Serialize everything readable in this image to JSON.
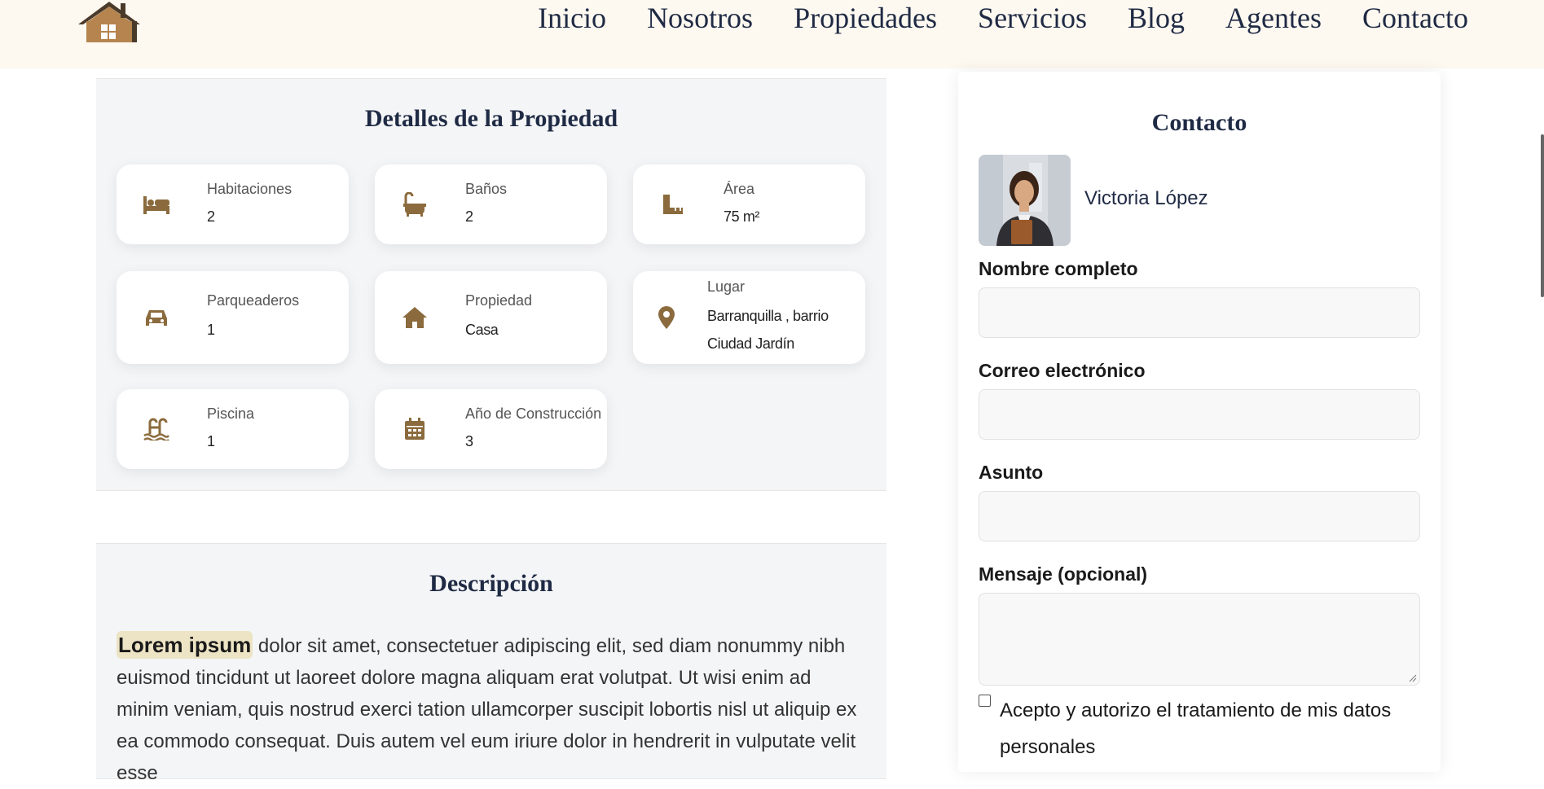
{
  "nav": {
    "items": [
      "Inicio",
      "Nosotros",
      "Propiedades",
      "Servicios",
      "Blog",
      "Agentes",
      "Contacto"
    ]
  },
  "details": {
    "title": "Detalles de la Propiedad",
    "cards": [
      {
        "label": "Habitaciones",
        "value": "2",
        "icon": "bed-icon"
      },
      {
        "label": "Baños",
        "value": "2",
        "icon": "bathtub-icon"
      },
      {
        "label": "Área",
        "value": "75 m²",
        "icon": "ruler-icon"
      },
      {
        "label": "Parqueaderos",
        "value": "1",
        "icon": "car-icon"
      },
      {
        "label": "Propiedad",
        "value": "Casa",
        "icon": "house-icon"
      },
      {
        "label": "Lugar",
        "value": "Barranquilla , barrio Ciudad Jardín",
        "icon": "location-pin-icon"
      },
      {
        "label": "Piscina",
        "value": "1",
        "icon": "swimming-pool-icon"
      },
      {
        "label": "Año de Construcción",
        "value": "3",
        "icon": "calendar-icon"
      }
    ]
  },
  "description": {
    "title": "Descripción",
    "highlight": "Lorem ipsum",
    "text": " dolor sit amet, consectetuer adipiscing elit, sed diam nonummy nibh euismod tincidunt ut laoreet dolore magna aliquam erat volutpat. Ut wisi enim ad minim veniam, quis nostrud exerci tation ullamcorper suscipit lobortis nisl ut aliquip ex ea commodo consequat. Duis autem vel eum iriure dolor in hendrerit in vulputate velit esse"
  },
  "contact": {
    "title": "Contacto",
    "agent_name": "Victoria López",
    "fields": [
      {
        "label": "Nombre completo",
        "value": ""
      },
      {
        "label": "Correo electrónico",
        "value": ""
      },
      {
        "label": "Asunto",
        "value": ""
      },
      {
        "label": "Mensaje (opcional)",
        "value": ""
      }
    ],
    "consent": "Acepto y autorizo el tratamiento de mis datos personales"
  },
  "colors": {
    "accent": "#8b6b3d",
    "header_bg": "#fdf8f0",
    "panel_bg": "#f4f5f7",
    "nav_text": "#1f2a44"
  }
}
